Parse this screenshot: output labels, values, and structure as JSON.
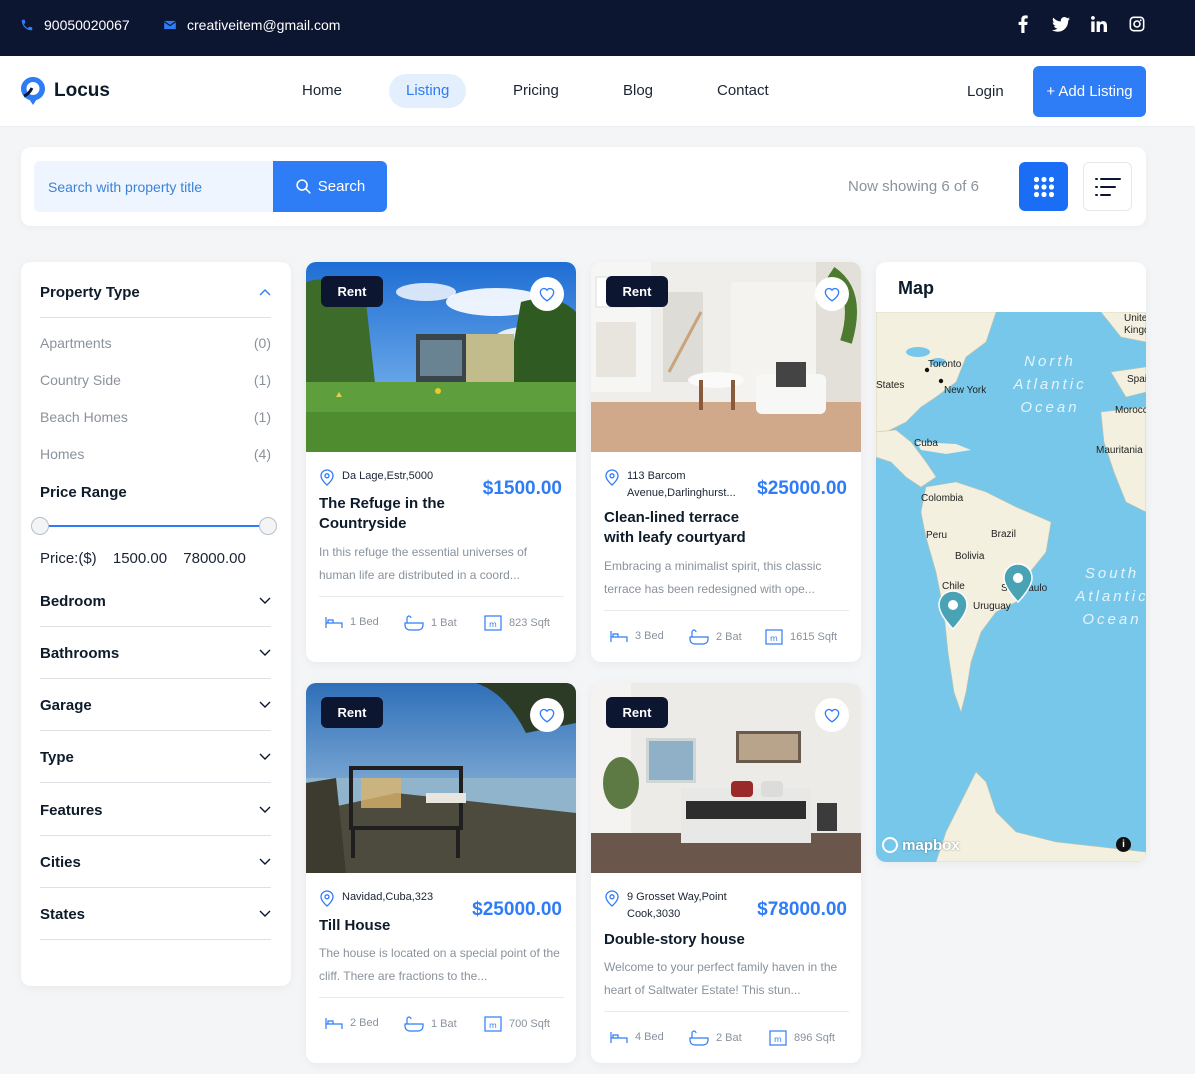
{
  "topbar": {
    "phone": "90050020067",
    "email": "creativeitem@gmail.com",
    "social": [
      "facebook-icon",
      "twitter-icon",
      "linkedin-icon",
      "instagram-icon"
    ]
  },
  "nav": {
    "logo": "Locus",
    "items": [
      "Home",
      "Listing",
      "Pricing",
      "Blog",
      "Contact"
    ],
    "active": "Listing",
    "login": "Login",
    "add_listing": "+ Add Listing"
  },
  "search": {
    "placeholder": "Search with property title",
    "button": "Search",
    "showing": "Now showing 6 of 6"
  },
  "filters": {
    "property_type": {
      "title": "Property Type",
      "items": [
        {
          "label": "Apartments",
          "count": "(0)"
        },
        {
          "label": "Country Side",
          "count": "(1)"
        },
        {
          "label": "Beach Homes",
          "count": "(1)"
        },
        {
          "label": "Homes",
          "count": "(4)"
        }
      ]
    },
    "price_range": {
      "title": "Price Range",
      "label": "Price:($)",
      "min": "1500.00",
      "max": "78000.00"
    },
    "collapsed": [
      "Bedroom",
      "Bathrooms",
      "Garage",
      "Type",
      "Features",
      "Cities",
      "States"
    ]
  },
  "listings": [
    {
      "badge": "Rent",
      "location": "Da Lage,Estr,5000",
      "price": "$1500.00",
      "title": "The Refuge in the Countryside",
      "description": "In this refuge the essential universes of human life are distributed in a coord...",
      "bed": "1 Bed",
      "bath": "1 Bat",
      "area": "823 Sqft"
    },
    {
      "badge": "Rent",
      "location": "113 Barcom Avenue,Darlinghurst...",
      "price": "$25000.00",
      "title": "Clean-lined terrace with leafy courtyard",
      "description": "Embracing a minimalist spirit, this classic terrace has been redesigned with ope...",
      "bed": "3 Bed",
      "bath": "2 Bat",
      "area": "1615 Sqft"
    },
    {
      "badge": "Rent",
      "location": "Navidad,Cuba,323",
      "price": "$25000.00",
      "title": "Till House",
      "description": "The house is located on a special point of the cliff. There are fractions to the...",
      "bed": "2 Bed",
      "bath": "1 Bat",
      "area": "700 Sqft"
    },
    {
      "badge": "Rent",
      "location": "9 Grosset Way,Point Cook,3030",
      "price": "$78000.00",
      "title": "Double-story house",
      "description": "Welcome to your perfect family haven in the heart of Saltwater Estate! This stun...",
      "bed": "4 Bed",
      "bath": "2 Bat",
      "area": "896 Sqft"
    }
  ],
  "map": {
    "title": "Map",
    "labels": [
      "Toronto",
      "New York",
      "States",
      "Cuba",
      "Colombia",
      "Peru",
      "Bolivia",
      "Brazil",
      "Chile",
      "Uruguay",
      "Sao Paulo",
      "Mauritania",
      "Morocco",
      "Spain",
      "United Kingdom"
    ],
    "oceans": [
      "North Atlantic Ocean",
      "South Atlantic Ocean"
    ],
    "attribution": "mapbox"
  }
}
